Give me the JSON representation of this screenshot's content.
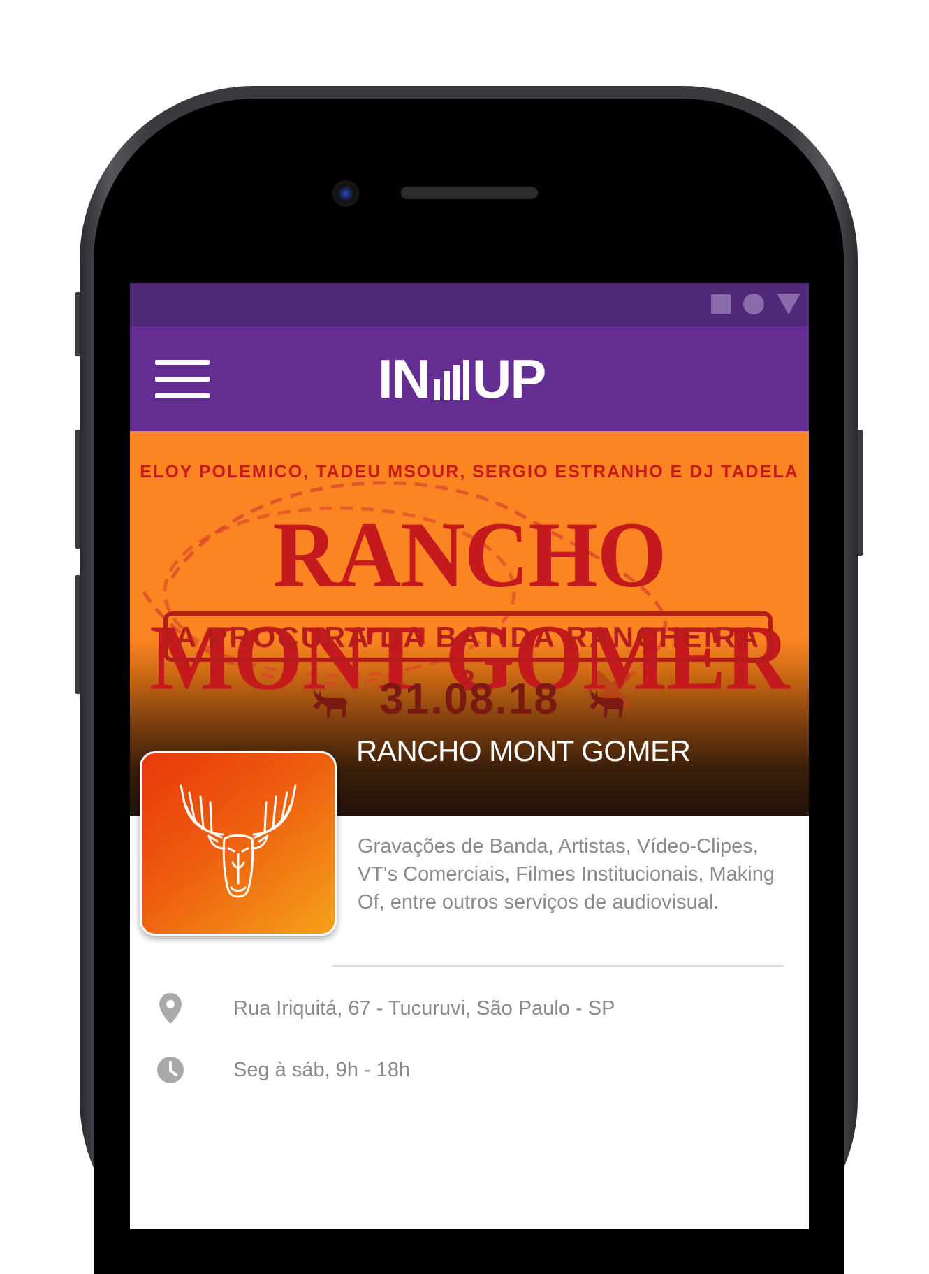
{
  "app": {
    "logo": {
      "left": "IN",
      "right": "UP"
    },
    "status_icons": [
      "square-icon",
      "circle-icon",
      "triangle-icon"
    ],
    "menu_icon": "hamburger-icon"
  },
  "banner": {
    "artists": "ELOY POLEMICO, TADEU MSOUR, SERGIO ESTRANHO E DJ TADELA",
    "poster_title": "RANCHO MONT GOMER",
    "subtitle": "A PROCURA DA BATIDA RANCHEIRA 2",
    "date": "31.08.18",
    "venue_title": "RANCHO MONT GOMER"
  },
  "details": {
    "description": "Gravações de Banda, Artistas, Vídeo-Clipes, VT's Comerciais, Filmes Institucionais, Making Of, entre outros serviços de audiovisual.",
    "address": "Rua Iriquitá, 67 - Tucuruvi, São Paulo - SP",
    "hours": "Seg à sáb, 9h - 18h",
    "address_icon": "location-pin-icon",
    "hours_icon": "clock-icon"
  },
  "colors": {
    "status_bar": "#4f2879",
    "app_bar": "#632d91",
    "banner_orange": "#fb8522",
    "poster_red": "#c41a1e",
    "text_gray": "#8a8a8a"
  }
}
